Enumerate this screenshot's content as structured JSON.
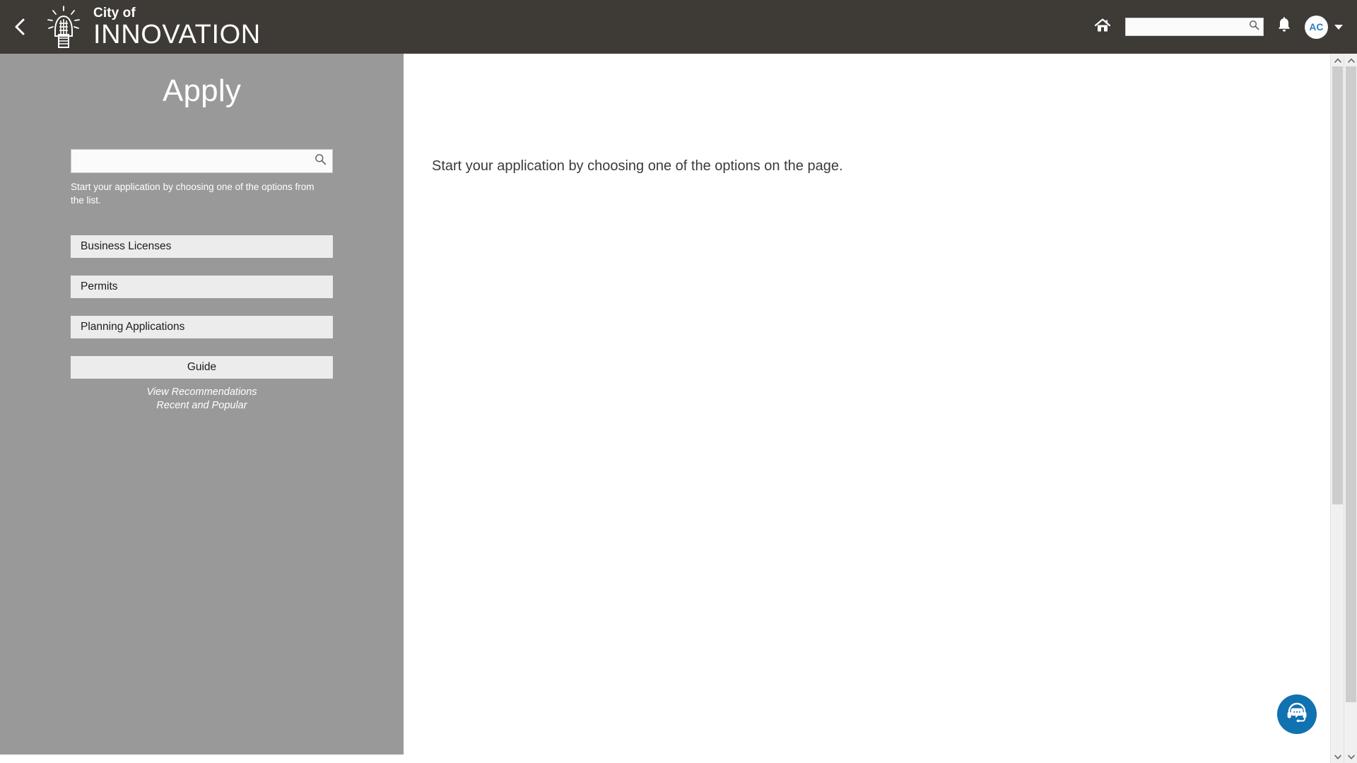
{
  "header": {
    "back_icon": "back-chevron-icon",
    "brand_line1": "City of",
    "brand_line2": "INNOVATION",
    "logo_icon": "lightbulb-building-logo",
    "home_icon": "home-icon",
    "search": {
      "value": "",
      "placeholder": "",
      "icon": "search-icon"
    },
    "notifications_icon": "bell-icon",
    "avatar_initials": "AC",
    "avatar_caret_icon": "chevron-down-icon",
    "background_color": "#3e3a36"
  },
  "left_panel": {
    "title": "Apply",
    "background_color": "#999999",
    "search": {
      "value": "",
      "placeholder": "",
      "icon": "search-icon"
    },
    "helper_text": "Start your application by choosing one of the options from the list.",
    "options": [
      {
        "label": "Business Licenses",
        "align": "left"
      },
      {
        "label": "Permits",
        "align": "left"
      },
      {
        "label": "Planning Applications",
        "align": "left"
      },
      {
        "label": "Guide",
        "align": "center"
      }
    ],
    "links": [
      {
        "label": "View Recommendations"
      },
      {
        "label": "Recent and Popular"
      }
    ]
  },
  "main": {
    "message": "Start your application by choosing one of the options on the page."
  },
  "chat_widget": {
    "icon": "headset-chat-icon",
    "color": "#1072b0"
  },
  "scrollbars": {
    "up_icon": "chevron-up-icon",
    "down_icon": "chevron-down-icon"
  }
}
